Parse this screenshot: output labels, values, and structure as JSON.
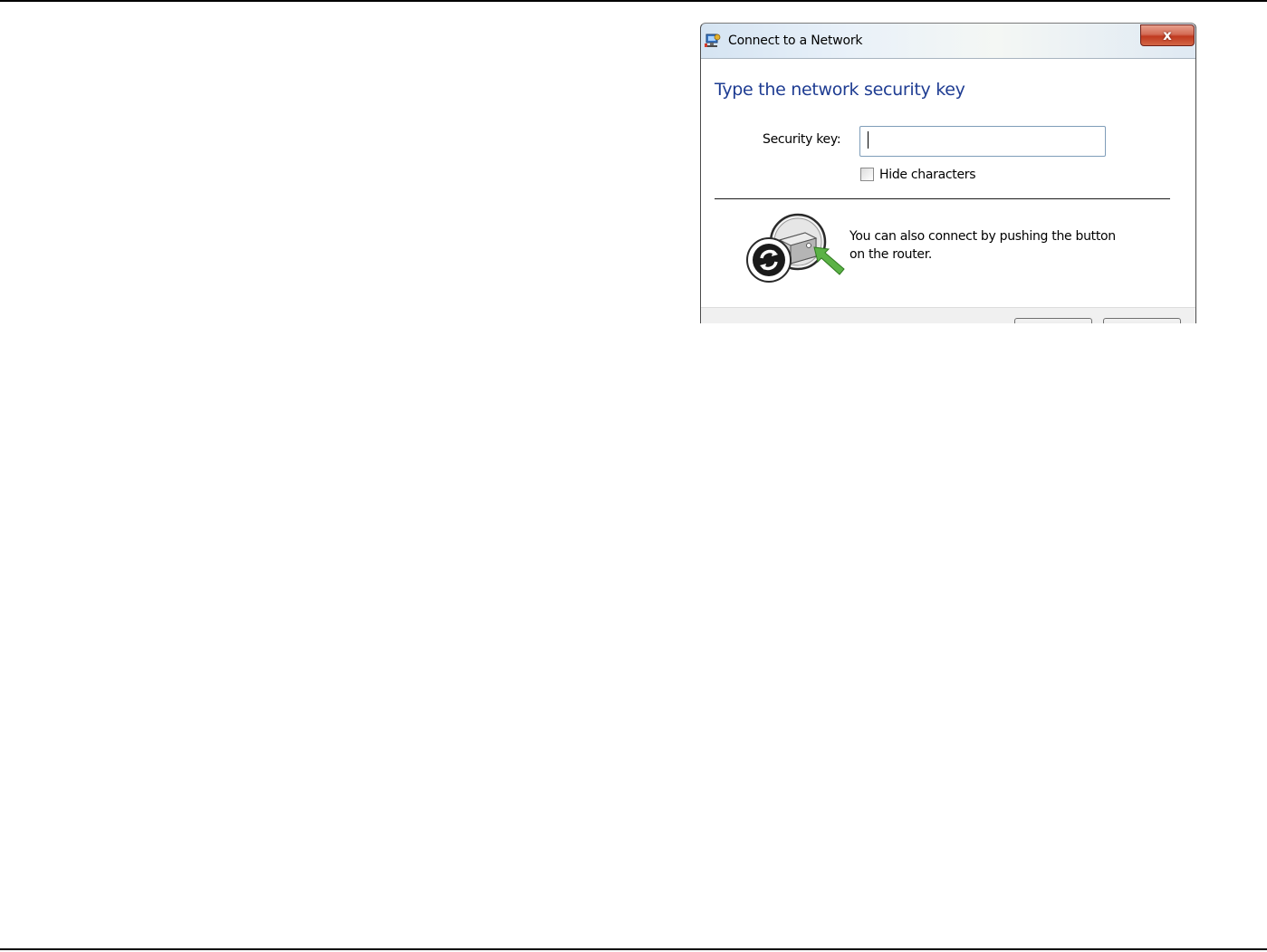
{
  "dialog": {
    "title": "Connect to a Network",
    "close_glyph": "x",
    "icon": "network-icon",
    "heading": "Type the network security key",
    "security_key_label": "Security key:",
    "security_key_value": "",
    "hide_characters_label": "Hide characters",
    "hide_characters_checked": false,
    "push_button_text": "You can also connect by pushing the button on the router.",
    "push_icon": "wps-router-icon",
    "footer_buttons": [
      "ok-button",
      "cancel-button"
    ]
  },
  "colors": {
    "heading": "#1e3c92",
    "close_button": "#c0391f",
    "arrow": "#5bb246"
  }
}
